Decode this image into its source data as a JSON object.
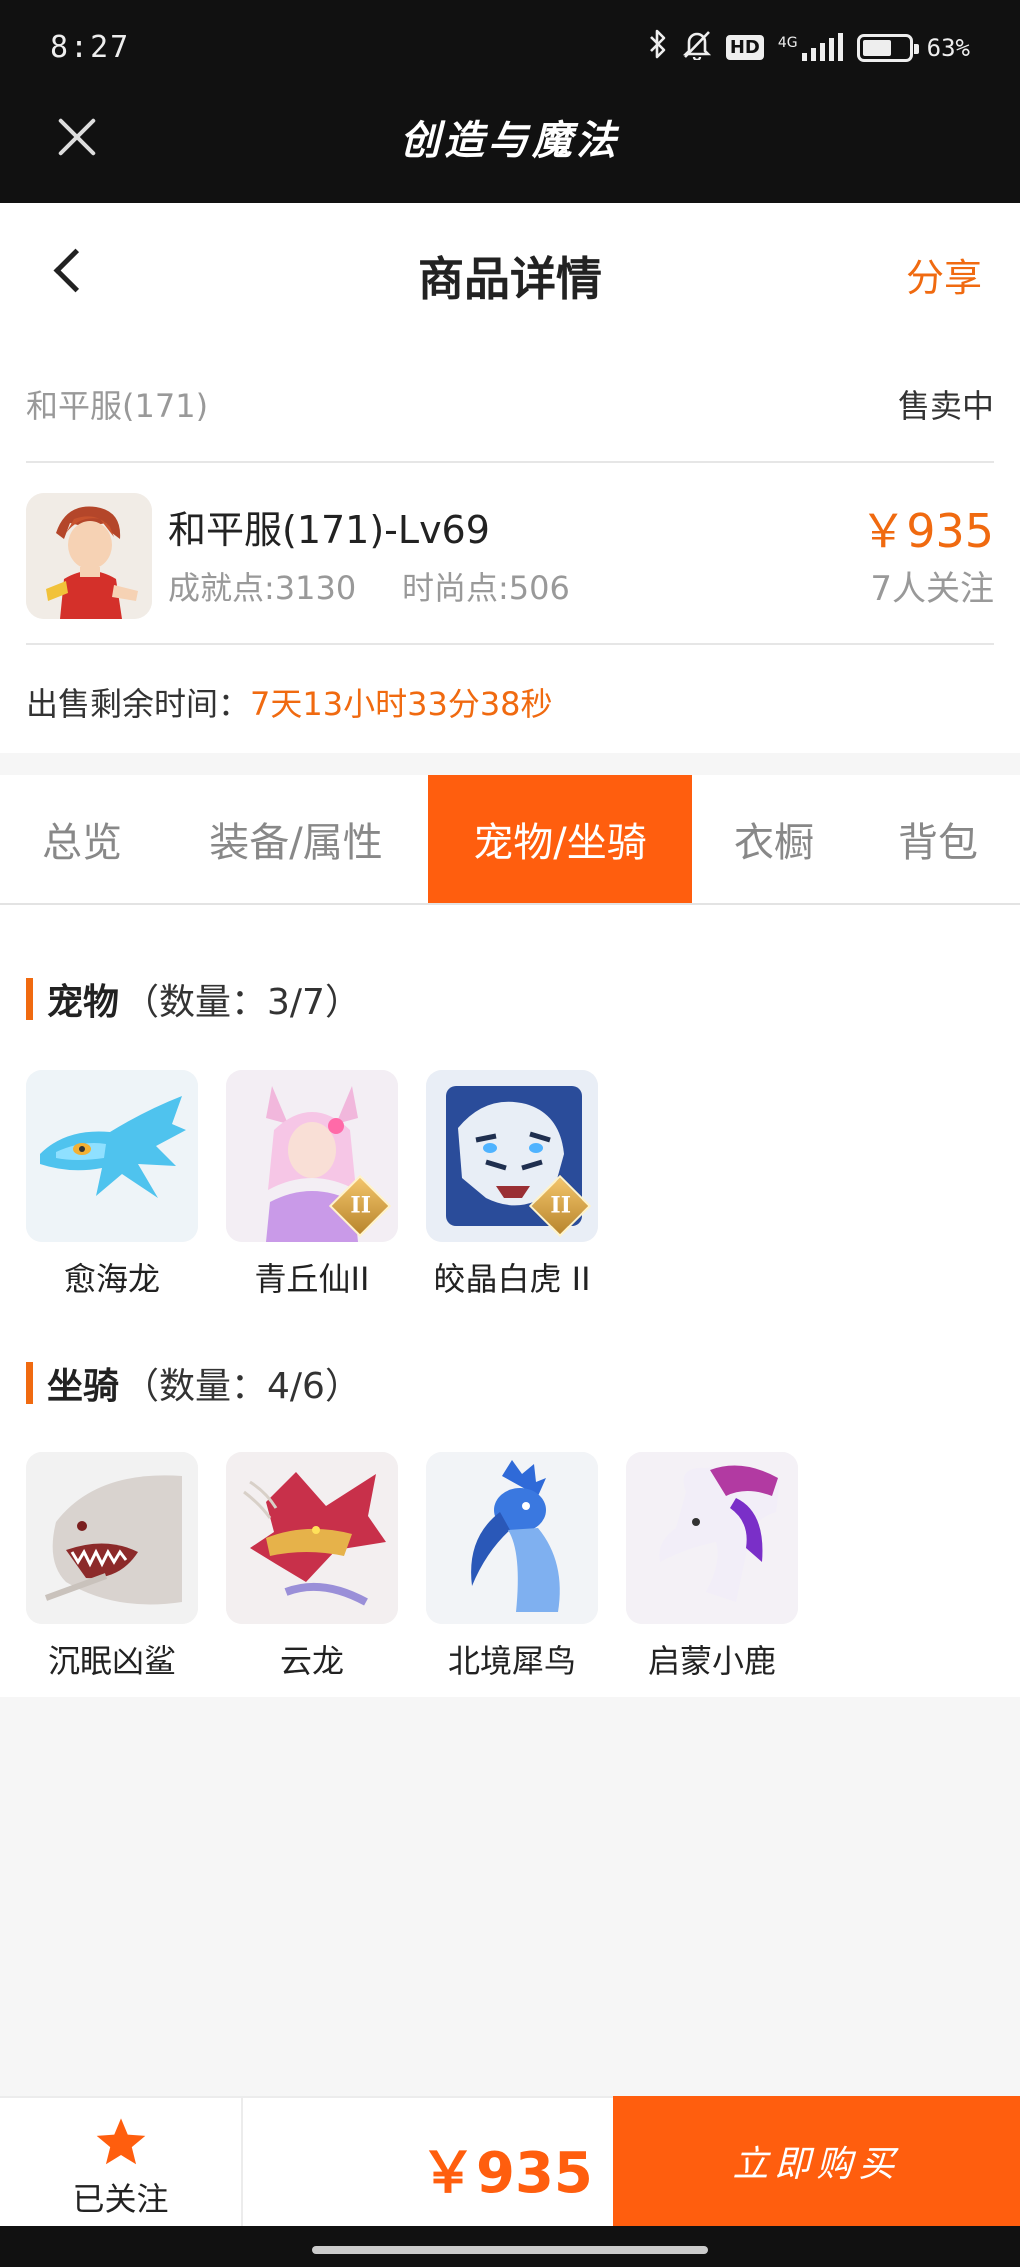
{
  "status_bar": {
    "time": "8:27",
    "hd": "HD",
    "network": "4G",
    "battery_text": "63%",
    "battery_level": 0.63
  },
  "app_header": {
    "title": "创造与魔法"
  },
  "nav": {
    "title": "商品详情",
    "share": "分享"
  },
  "listing": {
    "server": "和平服(171)",
    "status": "售卖中",
    "character_name": "和平服(171)-Lv69",
    "achievement": "成就点:3130",
    "fashion": "时尚点:506",
    "price": "￥935",
    "followers": "7人关注",
    "time_label": "出售剩余时间：",
    "time_value": "7天13小时33分38秒"
  },
  "tabs": [
    {
      "label": "总览",
      "active": false
    },
    {
      "label": "装备/属性",
      "active": false
    },
    {
      "label": "宠物/坐骑",
      "active": true
    },
    {
      "label": "衣橱",
      "active": false
    },
    {
      "label": "背包",
      "active": false
    }
  ],
  "pets": {
    "title": "宠物",
    "count": "（数量：3/7）",
    "items": [
      {
        "name": "愈海龙",
        "grade": ""
      },
      {
        "name": "青丘仙II",
        "grade": "II"
      },
      {
        "name": "皎晶白虎 II",
        "grade": "II"
      }
    ]
  },
  "mounts": {
    "title": "坐骑",
    "count": "（数量：4/6）",
    "items": [
      {
        "name": "沉眠凶鲨"
      },
      {
        "name": "云龙"
      },
      {
        "name": "北境犀鸟"
      },
      {
        "name": "启蒙小鹿"
      }
    ]
  },
  "bottom_bar": {
    "follow_label": "已关注",
    "price": "￥935",
    "buy_label": "立即购买"
  },
  "colors": {
    "accent": "#ff5e0e",
    "price_text": "#f06a10"
  }
}
